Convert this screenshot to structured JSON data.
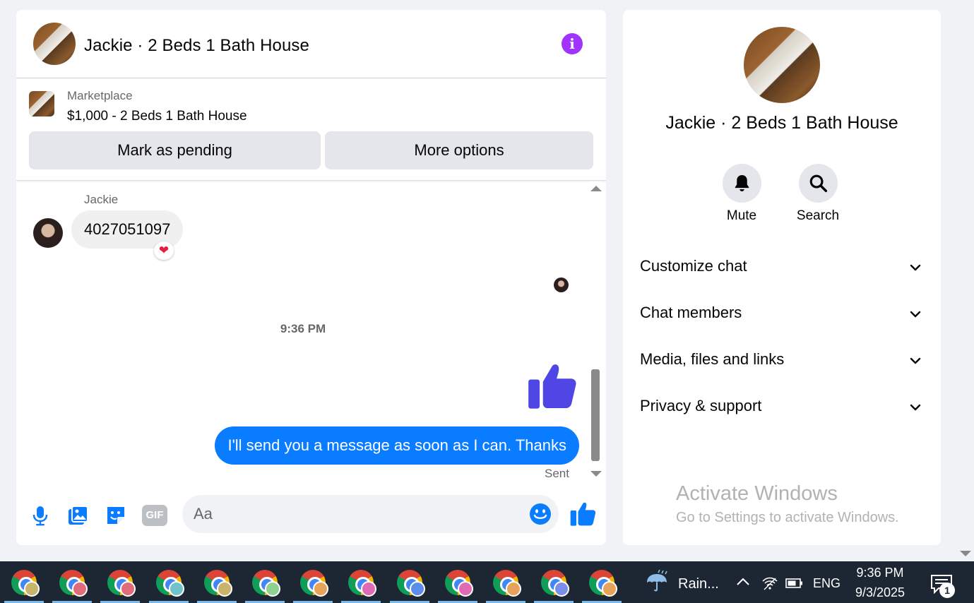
{
  "chat": {
    "header": {
      "title": "Jackie · 2 Beds 1 Bath House",
      "info_icon": "info-icon"
    },
    "listing": {
      "source": "Marketplace",
      "title": "$1,000 - 2 Beds 1 Bath House",
      "mark_pending_label": "Mark as pending",
      "more_options_label": "More options"
    },
    "messages": {
      "sender_name": "Jackie",
      "incoming_text": "4027051097",
      "incoming_reaction": "❤",
      "time_divider": "9:36 PM",
      "outgoing_like_icon": "thumbs-up-icon",
      "outgoing_text": "I'll send you a message as soon as I can. Thanks",
      "status": "Sent"
    },
    "composer": {
      "placeholder": "Aa",
      "value": "",
      "icons": [
        "microphone-icon",
        "photo-icon",
        "sticker-icon",
        "gif-icon",
        "emoji-icon",
        "thumbs-up-icon"
      ],
      "gif_label": "GIF"
    }
  },
  "info_panel": {
    "title": "Jackie · 2 Beds 1 Bath House",
    "mute_label": "Mute",
    "search_label": "Search",
    "sections": [
      {
        "label": "Customize chat"
      },
      {
        "label": "Chat members"
      },
      {
        "label": "Media, files and links"
      },
      {
        "label": "Privacy & support"
      }
    ]
  },
  "watermark": {
    "title": "Activate Windows",
    "subtitle": "Go to Settings to activate Windows."
  },
  "taskbar": {
    "apps_count": 13,
    "app_badge_colors": [
      "#c8b46a",
      "#e06b7a",
      "#e06b7a",
      "#6fc3c9",
      "#c8b46a",
      "#8fcf8f",
      "#e8a35b",
      "#e06bb5",
      "#5b8ee8",
      "#e06bb5",
      "#e8a35b",
      "#7a8ee8",
      "#e8a35b"
    ],
    "weather_text": "Rain...",
    "language": "ENG",
    "time": "9:36 PM",
    "date": "9/3/2025",
    "notification_count": "1"
  },
  "colors": {
    "messenger_blue": "#0a7cff",
    "like_purple": "#4f46e5",
    "info_purple": "#a033ff",
    "heart_red": "#e41e3f"
  }
}
